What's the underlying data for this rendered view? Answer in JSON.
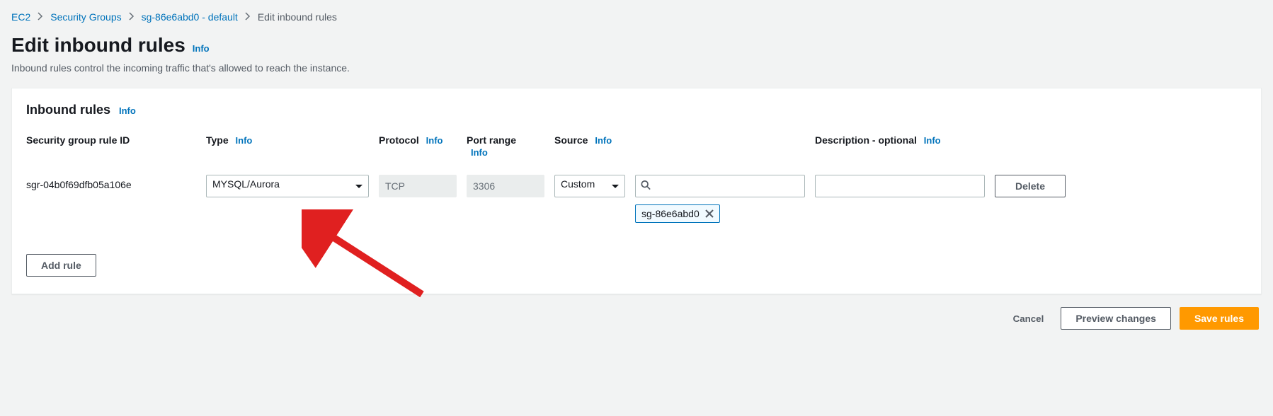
{
  "breadcrumb": {
    "items": [
      {
        "label": "EC2"
      },
      {
        "label": "Security Groups"
      },
      {
        "label": "sg-86e6abd0 - default"
      }
    ],
    "current": "Edit inbound rules"
  },
  "page": {
    "title": "Edit inbound rules",
    "info": "Info",
    "subtitle": "Inbound rules control the incoming traffic that's allowed to reach the instance."
  },
  "panel": {
    "title": "Inbound rules",
    "info": "Info"
  },
  "columns": {
    "rule_id": "Security group rule ID",
    "type": "Type",
    "protocol": "Protocol",
    "port_range": "Port range",
    "source": "Source",
    "description": "Description - optional",
    "info": "Info"
  },
  "rule": {
    "id": "sgr-04b0f69dfb05a106e",
    "type": "MYSQL/Aurora",
    "protocol": "TCP",
    "port_range": "3306",
    "source_mode": "Custom",
    "source_search": "",
    "source_tokens": [
      "sg-86e6abd0"
    ],
    "description": ""
  },
  "buttons": {
    "delete": "Delete",
    "add_rule": "Add rule",
    "cancel": "Cancel",
    "preview": "Preview changes",
    "save": "Save rules"
  }
}
